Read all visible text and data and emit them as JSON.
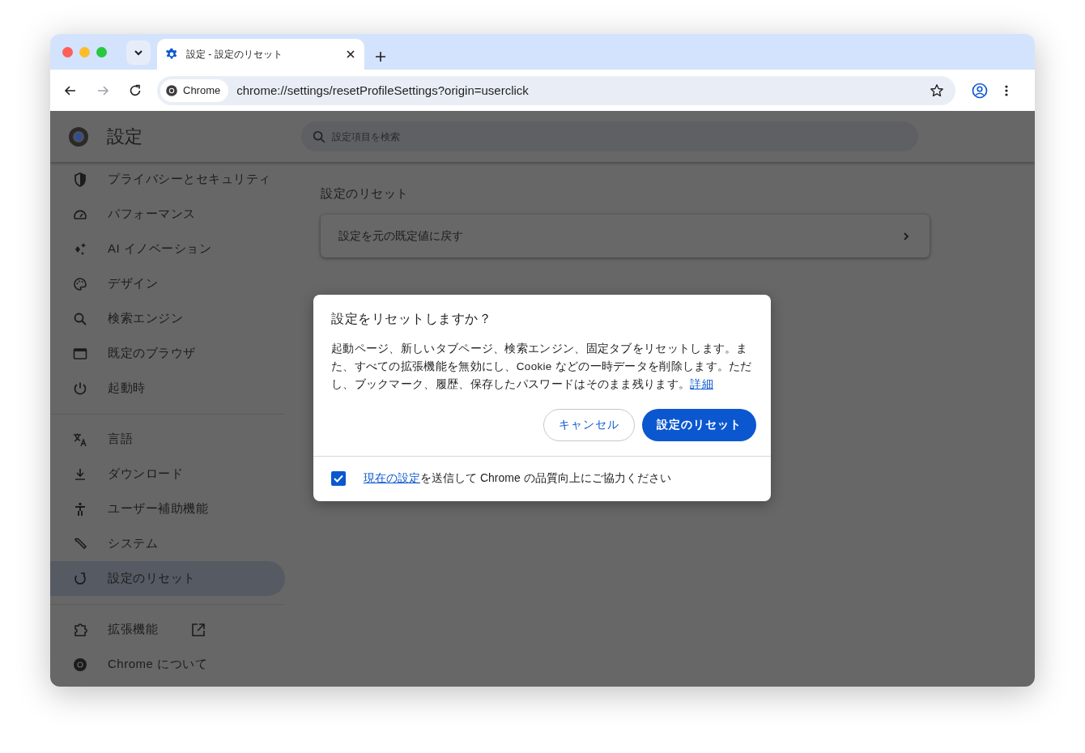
{
  "window": {
    "tabs": [
      {
        "title": "設定 - 設定のリセット",
        "selected": true
      }
    ],
    "nav": {
      "back_enabled": true,
      "forward_enabled": false
    },
    "address_bar": {
      "chip": "Chrome",
      "url": "chrome://settings/resetProfileSettings?origin=userclick"
    }
  },
  "settings": {
    "title": "設定",
    "search": {
      "placeholder": "設定項目を検索"
    },
    "sidebar": {
      "groups": [
        [
          {
            "label": "プライバシーとセキュリティ",
            "selected": false,
            "external": false
          },
          {
            "label": "パフォーマンス",
            "selected": false,
            "external": false
          },
          {
            "label": "AI イノベーション",
            "selected": false,
            "external": false
          },
          {
            "label": "デザイン",
            "selected": false,
            "external": false
          },
          {
            "label": "検索エンジン",
            "selected": false,
            "external": false
          },
          {
            "label": "既定のブラウザ",
            "selected": false,
            "external": false
          },
          {
            "label": "起動時",
            "selected": false,
            "external": false
          }
        ],
        [
          {
            "label": "言語",
            "selected": false,
            "external": false
          },
          {
            "label": "ダウンロード",
            "selected": false,
            "external": false
          },
          {
            "label": "ユーザー補助機能",
            "selected": false,
            "external": false
          },
          {
            "label": "システム",
            "selected": false,
            "external": false
          },
          {
            "label": "設定のリセット",
            "selected": true,
            "external": false
          }
        ],
        [
          {
            "label": "拡張機能",
            "selected": false,
            "external": true
          },
          {
            "label": "Chrome について",
            "selected": false,
            "external": false
          }
        ]
      ]
    },
    "section_title": "設定のリセット",
    "rows": [
      {
        "label": "設定を元の既定値に戻す"
      }
    ]
  },
  "dialog": {
    "title": "設定をリセットしますか？",
    "body": "起動ページ、新しいタブページ、検索エンジン、固定タブをリセットします。また、すべての拡張機能を無効にし、Cookie などの一時データを削除します。ただし、ブックマーク、履歴、保存したパスワードはそのまま残ります。",
    "link": "詳細",
    "buttons": [
      {
        "label": "キャンセル",
        "kind": "secondary"
      },
      {
        "label": "設定のリセット",
        "kind": "primary"
      }
    ],
    "checkbox": {
      "link": "現在の設定",
      "text": "を送信して Chrome の品質向上にご協力ください",
      "checked": true
    }
  }
}
